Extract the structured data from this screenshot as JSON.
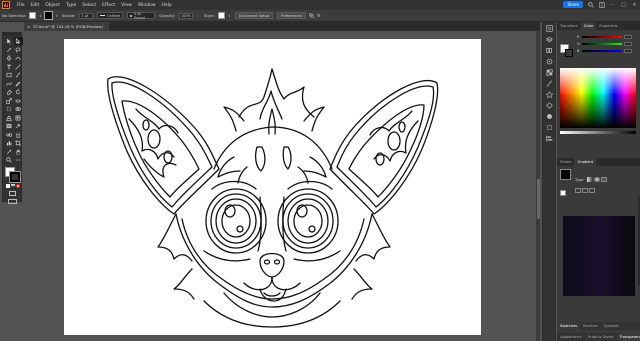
{
  "menubar": {
    "app_icon": "Ai",
    "items": [
      "File",
      "Edit",
      "Object",
      "Type",
      "Select",
      "Effect",
      "View",
      "Window",
      "Help"
    ],
    "share_label": "Share"
  },
  "controlbar": {
    "selection": "No Selection",
    "stroke_label": "Stroke:",
    "stroke_weight": "1 pt",
    "stroke_profile": "Uniform",
    "brush": "5 pt. Round",
    "opacity_label": "Opacity:",
    "opacity_value": "100%",
    "style_label": "Style:",
    "doc_setup": "Document Setup",
    "preferences": "Preferences"
  },
  "document": {
    "tab_title": "ST.Ad.ai* @ 104.16 % (RGB/Preview)"
  },
  "panels": {
    "top_tabs": [
      "Transform",
      "Color",
      "Properties"
    ],
    "mid_tabs": [
      "Stroke",
      "Gradient"
    ],
    "type_label": "Type:",
    "bottom_tabs_1": [
      "Appearance",
      "Graphic Styles",
      "Transparency"
    ],
    "bottom_tabs_2": [
      "Swatches",
      "Brushes",
      "Symbols"
    ]
  },
  "colors": {
    "accent": "#1473e6",
    "app_orange": "#ff9a00"
  }
}
